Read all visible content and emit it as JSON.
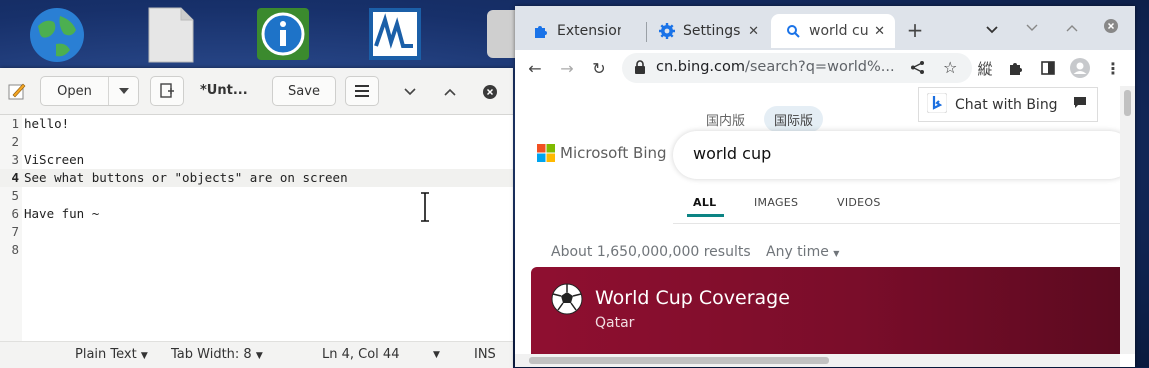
{
  "desktop": {
    "icons": [
      "globe-icon",
      "document-icon",
      "info-icon",
      "monitor-icon",
      "drive-icon"
    ]
  },
  "gedit": {
    "open_label": "Open",
    "save_label": "Save",
    "title": "*Unt...",
    "lines": [
      {
        "num": "1",
        "text": "hello!"
      },
      {
        "num": "2",
        "text": ""
      },
      {
        "num": "3",
        "text": "ViScreen"
      },
      {
        "num": "4",
        "text": "See what buttons or \"objects\" are on screen"
      },
      {
        "num": "5",
        "text": ""
      },
      {
        "num": "6",
        "text": "Have fun ~"
      },
      {
        "num": "7",
        "text": ""
      },
      {
        "num": "8",
        "text": ""
      }
    ],
    "current_line": 4,
    "status": {
      "language": "Plain Text",
      "tab_width": "Tab Width: 8",
      "position": "Ln 4, Col 44",
      "mode": "INS"
    }
  },
  "chrome": {
    "tabs": [
      {
        "label": "Extension",
        "icon": "puzzle-icon"
      },
      {
        "label": "Settings",
        "icon": "gear-icon"
      },
      {
        "label": "world cup",
        "icon": "search-icon"
      }
    ],
    "url_host": "cn.bing.com",
    "url_rest": "/search?q=world%...",
    "ext_label": "縱",
    "bing": {
      "chip_domestic": "国内版",
      "chip_international": "国际版",
      "chat_label": "Chat with Bing",
      "logo_text": "Microsoft Bing",
      "query": "world cup",
      "tab_all": "ALL",
      "tab_images": "IMAGES",
      "tab_videos": "VIDEOS",
      "results_count": "About 1,650,000,000 results",
      "time_filter": "Any time",
      "banner_title": "World Cup Coverage",
      "banner_subtitle": "Qatar"
    }
  },
  "colors": {
    "bing_accent": "#0c8484",
    "banner": "#8f0f30",
    "tab_strip": "#dee3ea"
  }
}
